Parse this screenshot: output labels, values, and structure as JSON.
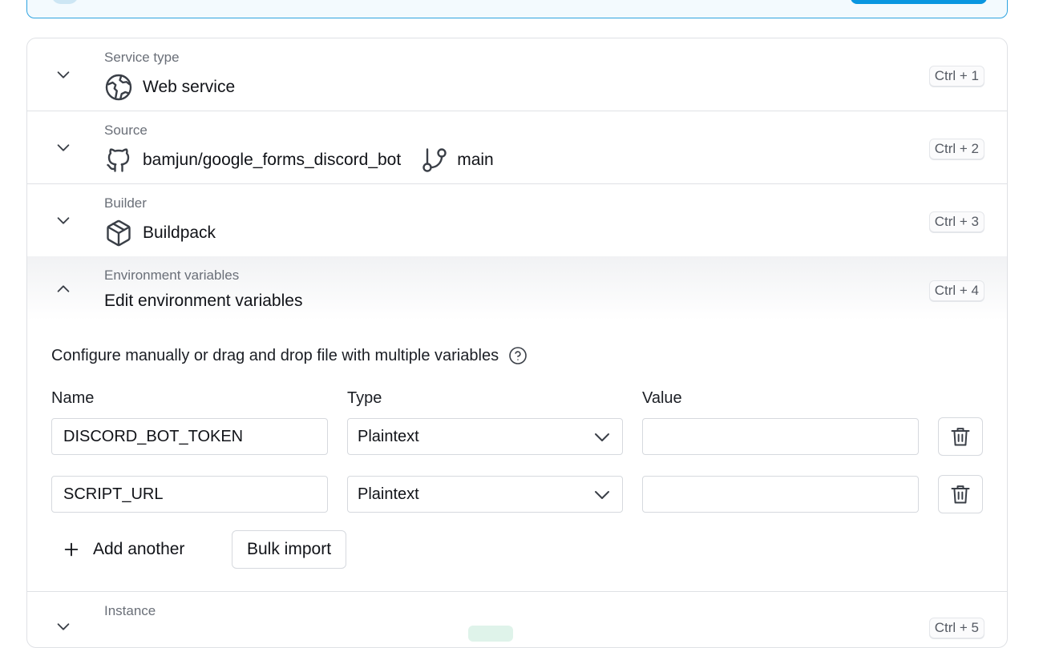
{
  "banner": {},
  "sections": {
    "service_type": {
      "label": "Service type",
      "value": "Web service",
      "icon": "globe-icon",
      "shortcut": "Ctrl + 1"
    },
    "source": {
      "label": "Source",
      "repo": "bamjun/google_forms_discord_bot",
      "repo_icon": "github-icon",
      "branch": "main",
      "branch_icon": "git-branch-icon",
      "shortcut": "Ctrl + 2"
    },
    "builder": {
      "label": "Builder",
      "value": "Buildpack",
      "icon": "package-icon",
      "shortcut": "Ctrl + 3"
    },
    "env": {
      "label": "Environment variables",
      "value": "Edit environment variables",
      "shortcut": "Ctrl + 4",
      "description": "Configure manually or drag and drop file with multiple variables",
      "columns": {
        "name": "Name",
        "type": "Type",
        "value": "Value"
      },
      "rows": [
        {
          "name": "DISCORD_BOT_TOKEN",
          "type": "Plaintext",
          "value": ""
        },
        {
          "name": "SCRIPT_URL",
          "type": "Plaintext",
          "value": ""
        }
      ],
      "add_label": "Add another",
      "bulk_label": "Bulk import"
    },
    "instance": {
      "label": "Instance",
      "shortcut": "Ctrl + 5"
    }
  },
  "colors": {
    "accent": "#0a96e0",
    "border": "#dfe1e5",
    "muted_text": "#6a6f78"
  }
}
